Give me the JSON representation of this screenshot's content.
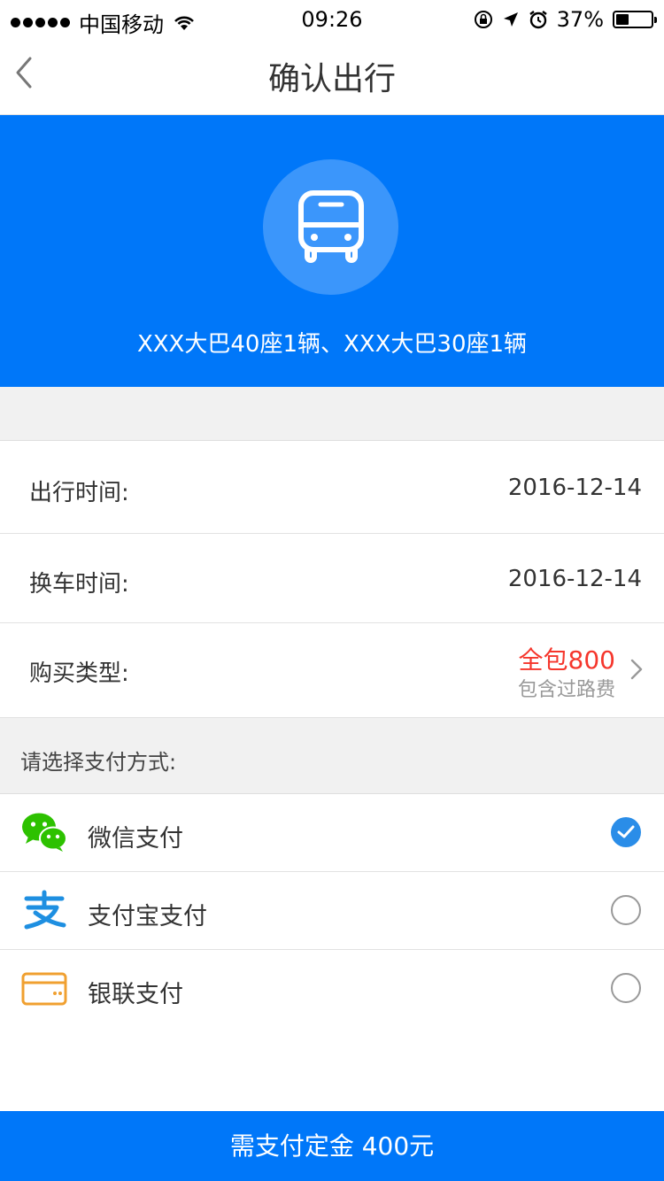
{
  "status_bar": {
    "carrier": "中国移动",
    "time": "09:26",
    "battery_percent": "37%",
    "battery_level": 0.37,
    "icons": [
      "signal-dots",
      "wifi-icon",
      "rotation-lock-icon",
      "location-icon",
      "alarm-icon",
      "battery-icon"
    ]
  },
  "nav": {
    "title": "确认出行",
    "back_icon": "chevron-left-icon"
  },
  "hero": {
    "icon": "bus-icon",
    "vehicles": "XXX大巴40座1辆、XXX大巴30座1辆"
  },
  "trip_info": {
    "departure_label": "出行时间:",
    "departure_value": "2016-12-14",
    "return_label": "换车时间:",
    "return_value": "2016-12-14",
    "purchase_label": "购买类型:",
    "purchase_price": "全包800",
    "purchase_note": "包含过路费"
  },
  "payment": {
    "header": "请选择支付方式:",
    "methods": [
      {
        "label": "微信支付",
        "icon": "wechat-icon",
        "selected": true
      },
      {
        "label": "支付宝支付",
        "icon": "alipay-icon",
        "selected": false
      },
      {
        "label": "银联支付",
        "icon": "unionpay-card-icon",
        "selected": false
      }
    ]
  },
  "footer": {
    "pay_button": "需支付定金 400元"
  },
  "colors": {
    "primary": "#0077f9",
    "price": "#f5362c",
    "check": "#2a8de8",
    "wechat": "#2dc100",
    "alipay": "#1e8fe1",
    "unionpay": "#f0a030"
  }
}
